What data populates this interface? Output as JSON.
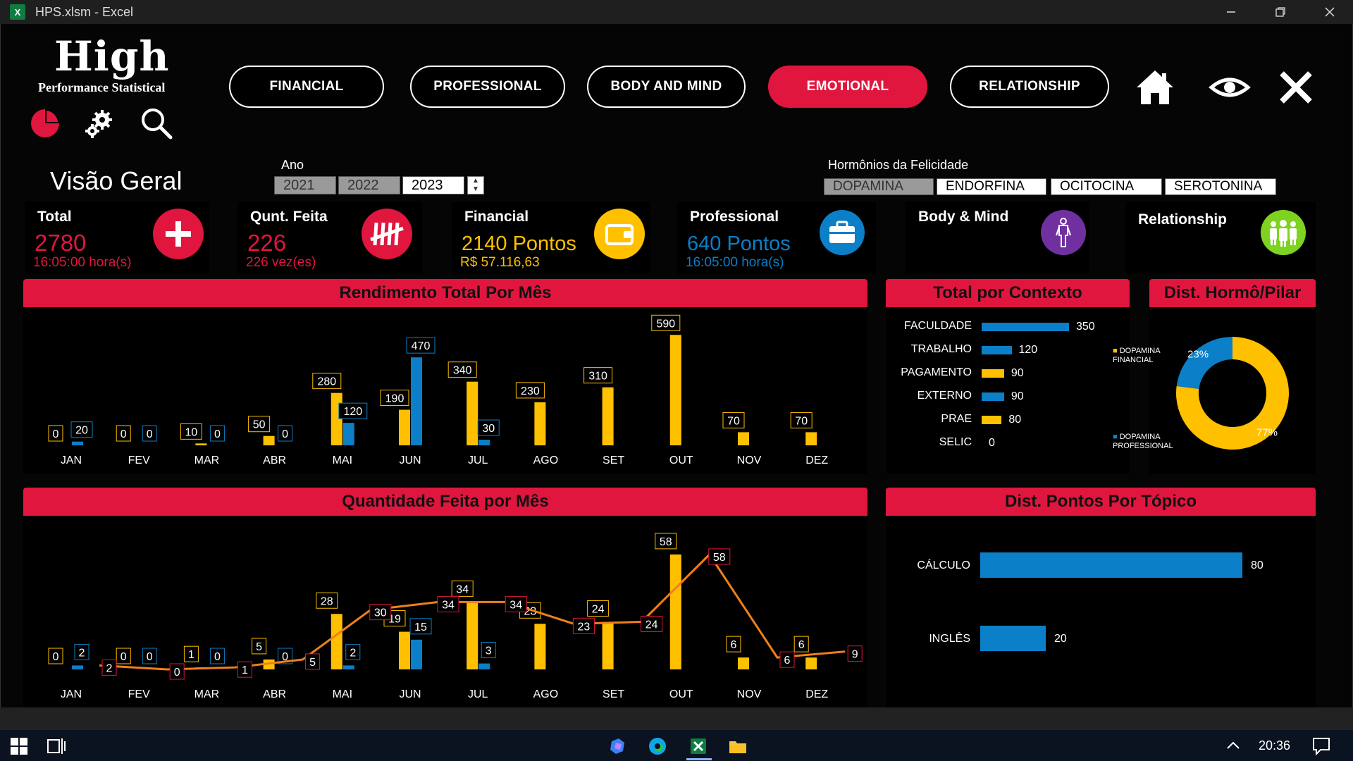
{
  "window": {
    "title": "HPS.xlsm - Excel",
    "app_icon": "X"
  },
  "logo": {
    "title": "High",
    "subtitle": "Performance Statistical"
  },
  "nav": [
    "FINANCIAL",
    "PROFESSIONAL",
    "BODY AND MIND",
    "EMOTIONAL",
    "RELATIONSHIP"
  ],
  "nav_active": "EMOTIONAL",
  "overview": {
    "title": "Visão Geral",
    "year_label": "Ano",
    "years": [
      "2021",
      "2022",
      "2023"
    ],
    "selected_year": "2023"
  },
  "hormones": {
    "label": "Hormônios da Felicidade",
    "items": [
      "DOPAMINA",
      "ENDORFINA",
      "OCITOCINA",
      "SEROTONINA"
    ],
    "selected": "DOPAMINA"
  },
  "kpis": {
    "total": {
      "title": "Total",
      "value": "2780",
      "sub": "16:05:00 hora(s)"
    },
    "qty": {
      "title": "Qunt. Feita",
      "value": "226",
      "sub": "226 vez(es)"
    },
    "financial": {
      "title": "Financial",
      "value": "2140 Pontos",
      "sub": "R$ 57.116,63"
    },
    "professional": {
      "title": "Professional",
      "value": "640 Pontos",
      "sub": "16:05:00 hora(s)"
    },
    "body": {
      "title": "Body & Mind"
    },
    "relationship": {
      "title": "Relationship"
    }
  },
  "colors": {
    "accent": "#e0163f",
    "yellow": "#ffc000",
    "blue": "#0b7fc7",
    "orange": "#f07f1a",
    "purple": "#7030a0",
    "green": "#7ed321"
  },
  "chart_data": [
    {
      "type": "bar",
      "title": "Rendimento Total Por Mês",
      "categories": [
        "JAN",
        "FEV",
        "MAR",
        "ABR",
        "MAI",
        "JUN",
        "JUL",
        "AGO",
        "SET",
        "OUT",
        "NOV",
        "DEZ"
      ],
      "series": [
        {
          "color": "#ffc000",
          "values": [
            0,
            0,
            10,
            50,
            280,
            190,
            340,
            230,
            310,
            590,
            70,
            70
          ]
        },
        {
          "color": "#0b7fc7",
          "values": [
            20,
            0,
            0,
            0,
            120,
            470,
            30,
            null,
            null,
            null,
            null,
            null
          ]
        }
      ],
      "ylim": [
        0,
        640
      ]
    },
    {
      "type": "bar",
      "title": "Quantidade Feita por Mês",
      "categories": [
        "JAN",
        "FEV",
        "MAR",
        "ABR",
        "MAI",
        "JUN",
        "JUL",
        "AGO",
        "SET",
        "OUT",
        "NOV",
        "DEZ"
      ],
      "series": [
        {
          "color": "#ffc000",
          "values": [
            0,
            0,
            1,
            5,
            28,
            19,
            34,
            23,
            24,
            58,
            6,
            6
          ]
        },
        {
          "color": "#0b7fc7",
          "values": [
            2,
            0,
            0,
            0,
            2,
            15,
            3,
            null,
            null,
            null,
            null,
            null
          ]
        },
        {
          "type": "line",
          "color": "#f07f1a",
          "values": [
            2,
            0,
            1,
            5,
            30,
            34,
            34,
            23,
            24,
            58,
            6,
            9
          ]
        }
      ],
      "ylim": [
        0,
        64
      ]
    },
    {
      "type": "bar",
      "orientation": "horizontal",
      "title": "Total por Contexto",
      "categories": [
        "FACULDADE",
        "TRABALHO",
        "PAGAMENTO",
        "EXTERNO",
        "PRAE",
        "SELIC"
      ],
      "values": [
        350,
        120,
        90,
        90,
        80,
        0
      ],
      "colors": [
        "#0b7fc7",
        "#0b7fc7",
        "#ffc000",
        "#0b7fc7",
        "#ffc000",
        "#0b7fc7"
      ]
    },
    {
      "type": "pie",
      "title": "Dist. Hormô/Pilar",
      "labels": [
        "DOPAMINA PROFESSIONAL",
        "DOPAMINA FINANCIAL"
      ],
      "values": [
        23,
        77
      ],
      "value_labels": [
        "23%",
        "77%"
      ],
      "colors": [
        "#0b7fc7",
        "#ffc000"
      ]
    },
    {
      "type": "bar",
      "orientation": "horizontal",
      "title": "Dist. Pontos Por Tópico",
      "categories": [
        "CÁLCULO",
        "INGLÊS"
      ],
      "values": [
        80,
        20
      ],
      "color": "#0b7fc7"
    }
  ],
  "taskbar": {
    "time": "20:36"
  }
}
